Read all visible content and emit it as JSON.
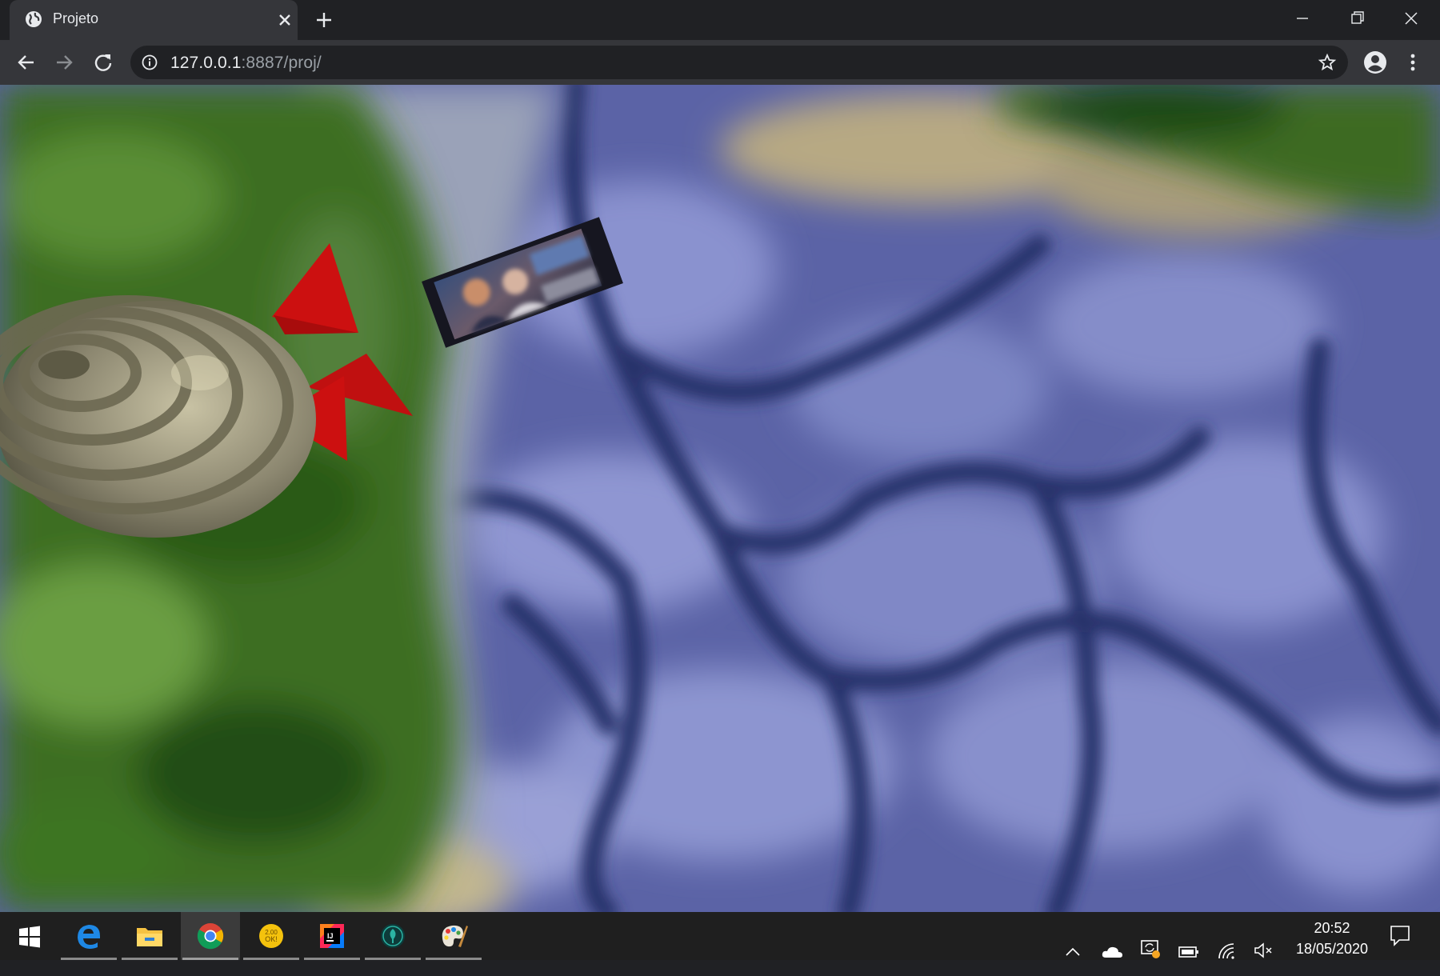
{
  "browser": {
    "tab_title": "Projeto",
    "url_host": "127.0.0.1",
    "url_rest": ":8887/proj/"
  },
  "scene": {
    "description_colors": {
      "grass": "#3f6f22",
      "stone": "#5a62a8",
      "airship": "#8a8670",
      "fins": "#cc1111"
    }
  },
  "taskbar": {
    "apps": [
      {
        "name": "start",
        "icon": "windows-icon"
      },
      {
        "name": "edge",
        "icon": "edge-icon"
      },
      {
        "name": "explorer",
        "icon": "folder-icon"
      },
      {
        "name": "chrome",
        "icon": "chrome-icon",
        "active": true
      },
      {
        "name": "app-yellow",
        "icon": "yellow-app-icon",
        "label": "2.00\nOK!"
      },
      {
        "name": "intellij",
        "icon": "intellij-icon",
        "label": "IJ"
      },
      {
        "name": "app-teal",
        "icon": "teal-app-icon"
      },
      {
        "name": "paint",
        "icon": "paint-icon"
      }
    ],
    "time": "20:52",
    "date": "18/05/2020"
  }
}
